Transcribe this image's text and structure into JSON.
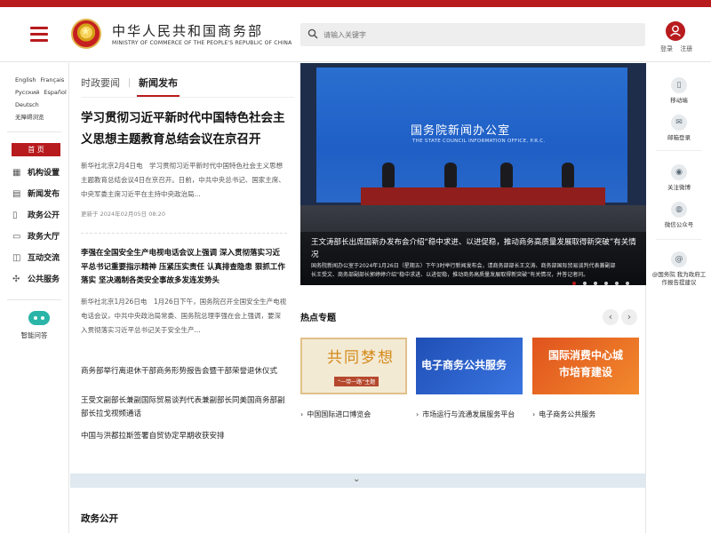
{
  "header": {
    "site_title": "中华人民共和国商务部",
    "site_subtitle": "MINISTRY OF COMMERCE OF THE PEOPLE'S REPUBLIC OF CHINA",
    "search_placeholder": "请输入关键字",
    "login": "登录",
    "register": "注册",
    "accent_color": "#b81b1e"
  },
  "left_nav": {
    "languages": [
      "English",
      "Français",
      "Русский",
      "Español",
      "Deutsch"
    ],
    "accessibility": "无障碍浏览",
    "home": "首 页",
    "items": [
      {
        "label": "机构设置",
        "icon": "building-icon"
      },
      {
        "label": "新闻发布",
        "icon": "newspaper-icon"
      },
      {
        "label": "政务公开",
        "icon": "document-icon"
      },
      {
        "label": "政务大厅",
        "icon": "monitor-icon"
      },
      {
        "label": "互动交流",
        "icon": "chat-icon"
      },
      {
        "label": "公共服务",
        "icon": "service-icon"
      }
    ],
    "ai_label": "智能问答"
  },
  "main": {
    "tabs": [
      "时政要闻",
      "新闻发布"
    ],
    "headline": "学习贯彻习近平新时代中国特色社会主义思想主题教育总结会议在京召开",
    "summary": "新华社北京2月4日电　学习贯彻习近平新时代中国特色社会主义思想主题教育总结会议4日在京召开。日前，中共中央总书记、国家主席、中央军委主席习近平在主持中央政治局...",
    "updated": "更新于 2024年02月05日 08:20",
    "headline2": "李强在全国安全生产电视电话会议上强调 深入贯彻落实习近平总书记重要指示精神 压紧压实责任 认真排查隐患 狠抓工作落实 坚决遏制各类安全事故多发连发势头",
    "summary2": "新华社北京1月26日电　1月26日下午，国务院召开全国安全生产电视电话会议，中共中央政治局常委、国务院总理李强在会上强调，要深入贯彻落实习近平总书记关于安全生产...",
    "news": [
      "商务部举行离退休干部商务形势报告会暨干部荣誉退休仪式",
      "王受文副部长兼副国际贸易谈判代表兼副部长同美国商务部副部长拉戈视频通话",
      "中国与洪都拉斯签署自贸协定早期收获安排"
    ],
    "hero": {
      "wall_title": "国务院新闻办公室",
      "wall_en": "THE STATE COUNCIL INFORMATION OFFICE, P.R.C.",
      "caption": "王文涛部长出席国新办发布会介绍“稳中求进、以进促稳，推动商务高质量发展取得新突破”有关情况",
      "desc": "国务院新闻办公室于2024年1月26日（星期五）下午3时举行新闻发布会，请商务部部长王文涛、商务部国际贸易谈判代表兼副部长王受文、商务部副部长郭婷婷介绍“稳中求进、以进促稳，推动商务高质量发展取得新突破”有关情况，并答记者问。",
      "slides": 6,
      "active_slide": 1
    },
    "topics_title": "热点专题",
    "prev": "‹",
    "next": "›",
    "banners": [
      {
        "text": "共同梦想",
        "sub": "“一带一路”主题"
      },
      {
        "text": "电子商务公共服务"
      },
      {
        "text": "国际消费中心城市培育建设"
      }
    ],
    "topics": [
      "中国国际进口博览会",
      "市场运行与流通发展服务平台",
      "电子商务公共服务"
    ],
    "expand": "⌄",
    "section_title": "政务公开"
  },
  "right_col": [
    {
      "label": "移动端",
      "icon": "mobile-icon",
      "glyph": "▯"
    },
    {
      "label": "邮箱登录",
      "icon": "mail-icon",
      "glyph": "✉"
    },
    {
      "label": "关注微博",
      "icon": "weibo-icon",
      "glyph": "◉"
    },
    {
      "label": "微信公众号",
      "icon": "wechat-icon",
      "glyph": "◍"
    },
    {
      "label": "@国务院 我为政府工作报告提建议",
      "icon": "at-icon",
      "glyph": "@"
    }
  ]
}
